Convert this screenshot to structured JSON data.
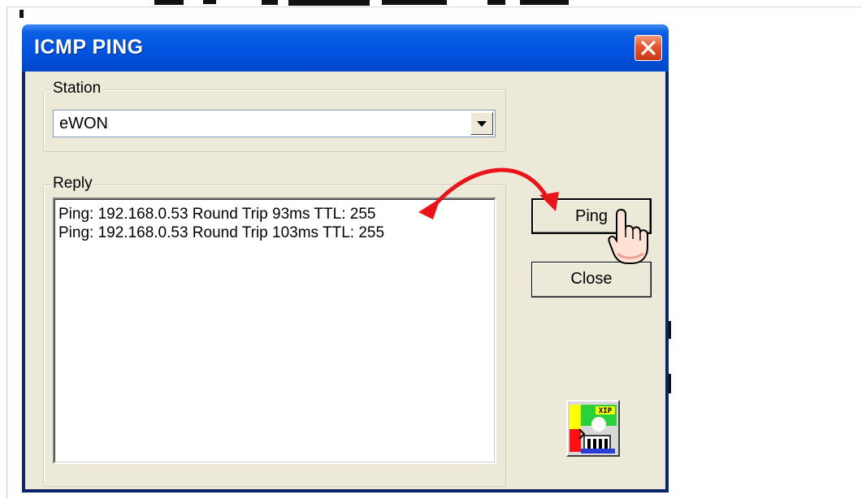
{
  "window": {
    "title": "ICMP PING"
  },
  "station": {
    "group_label": "Station",
    "selected_value": "eWON"
  },
  "reply": {
    "group_label": "Reply",
    "lines": [
      "Ping: 192.168.0.53 Round Trip 93ms TTL: 255",
      "Ping: 192.168.0.53 Round Trip 103ms TTL: 255"
    ]
  },
  "buttons": {
    "ping_label": "Ping",
    "close_label": "Close"
  },
  "app_icon": {
    "badge": "XIP",
    "icon": "ewon-xip-icon"
  },
  "colors": {
    "titlebar": "#0054e3",
    "dialog_bg": "#ece9d8",
    "close_button": "#e2542f",
    "annotation_arrow": "#e8141a"
  },
  "icons": [
    "close-icon",
    "dropdown-arrow-icon",
    "hand-cursor-icon",
    "ewon-xip-icon"
  ]
}
